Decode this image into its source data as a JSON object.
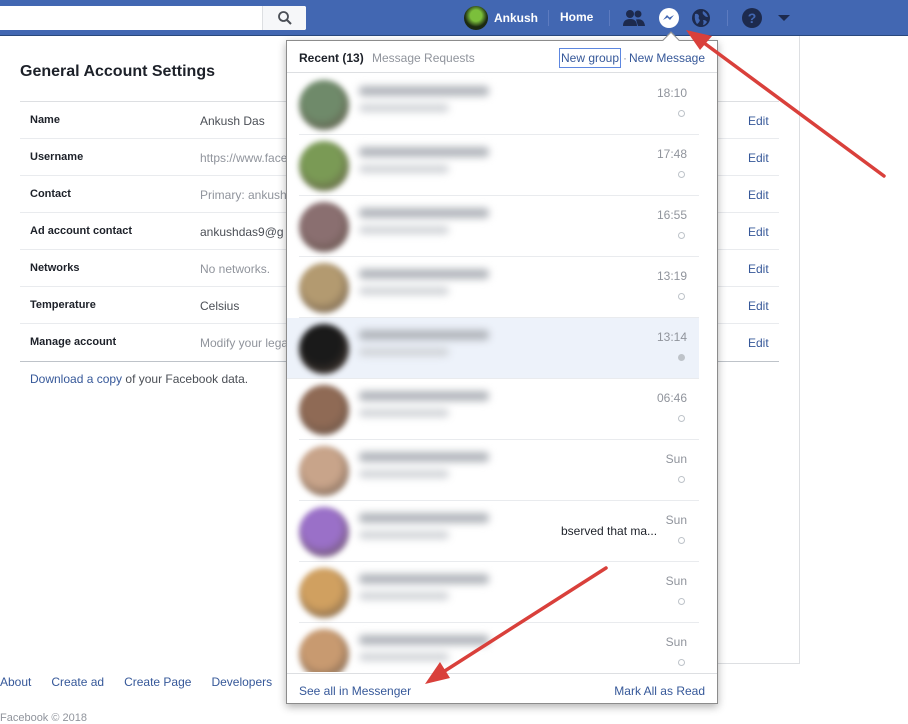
{
  "topbar": {
    "profile_name": "Ankush",
    "home_label": "Home"
  },
  "settings": {
    "title": "General Account Settings",
    "rows": [
      {
        "label": "Name",
        "value": "Ankush Das",
        "edit": "Edit"
      },
      {
        "label": "Username",
        "value": "https://www.face",
        "edit": "Edit"
      },
      {
        "label": "Contact",
        "value": "Primary: ankush",
        "edit": "Edit"
      },
      {
        "label": "Ad account contact",
        "value": "ankushdas9@g",
        "edit": "Edit"
      },
      {
        "label": "Networks",
        "value": "No networks.",
        "edit": "Edit"
      },
      {
        "label": "Temperature",
        "value": "Celsius",
        "edit": "Edit"
      },
      {
        "label": "Manage account",
        "value": "Modify your lega",
        "edit": "Edit"
      }
    ],
    "download_link": "Download a copy",
    "download_suffix": " of your Facebook data."
  },
  "footer": {
    "links": [
      "About",
      "Create ad",
      "Create Page",
      "Developers"
    ],
    "copyright": "Facebook © 2018"
  },
  "messenger": {
    "tab_recent": "Recent (13)",
    "tab_requests": "Message Requests",
    "new_group": "New group",
    "separator": "·",
    "new_message": "New Message",
    "threads": [
      {
        "time": "18:10",
        "snippet": "",
        "avatar_color": "#6f8a6a"
      },
      {
        "time": "17:48",
        "snippet": "",
        "avatar_color": "#7a9a55"
      },
      {
        "time": "16:55",
        "snippet": "",
        "avatar_color": "#8a6f70"
      },
      {
        "time": "13:19",
        "snippet": "",
        "avatar_color": "#b39a70"
      },
      {
        "time": "13:14",
        "snippet": "",
        "avatar_color": "#1a1a1a"
      },
      {
        "time": "06:46",
        "snippet": "",
        "avatar_color": "#8f6a55"
      },
      {
        "time": "Sun",
        "snippet": "",
        "avatar_color": "#c8a48a"
      },
      {
        "time": "Sun",
        "snippet": "bserved that ma...",
        "avatar_color": "#9a70c8"
      },
      {
        "time": "Sun",
        "snippet": "",
        "avatar_color": "#d0a060"
      },
      {
        "time": "Sun",
        "snippet": "",
        "avatar_color": "#c89a70"
      }
    ],
    "see_all": "See all in Messenger",
    "mark_all": "Mark All as Read"
  },
  "colors": {
    "brand_blue": "#4267b2",
    "link_blue": "#365899",
    "annotation_red": "#d9403b"
  }
}
